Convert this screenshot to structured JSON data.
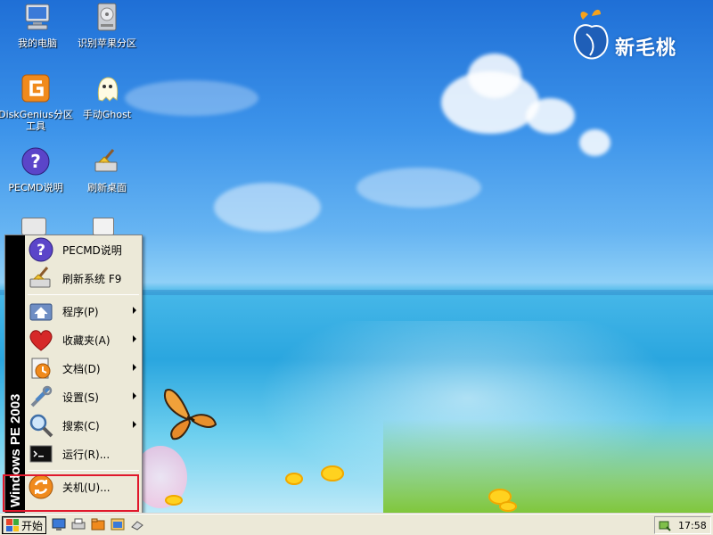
{
  "desktop": {
    "icons": [
      {
        "label": "我的电脑",
        "icon": "computer-icon"
      },
      {
        "label": "识别苹果分区",
        "icon": "drive-icon"
      },
      {
        "label": "DiskGenius分区工具",
        "icon": "diskgenius-icon"
      },
      {
        "label": "手动Ghost",
        "icon": "ghost-icon"
      },
      {
        "label": "PECMD说明",
        "icon": "help-icon"
      },
      {
        "label": "刷新桌面",
        "icon": "broom-icon"
      }
    ],
    "logo_text": "新毛桃"
  },
  "start_menu": {
    "banner": "Windows PE 2003",
    "top_items": [
      {
        "label": "PECMD说明",
        "icon": "help-icon"
      },
      {
        "label": "刷新系统 F9",
        "icon": "broom-icon"
      }
    ],
    "items": [
      {
        "label": "程序(P)",
        "icon": "programs-icon",
        "submenu": true
      },
      {
        "label": "收藏夹(A)",
        "icon": "heart-icon",
        "submenu": true
      },
      {
        "label": "文档(D)",
        "icon": "documents-icon",
        "submenu": true
      },
      {
        "label": "设置(S)",
        "icon": "settings-icon",
        "submenu": true
      },
      {
        "label": "搜索(C)",
        "icon": "search-icon",
        "submenu": true
      },
      {
        "label": "运行(R)...",
        "icon": "run-icon",
        "submenu": false
      }
    ],
    "shutdown": {
      "label": "关机(U)...",
      "icon": "shutdown-icon"
    }
  },
  "taskbar": {
    "start_label": "开始",
    "quick_launch": [
      "desktop-icon",
      "printer-icon",
      "folder-icon",
      "explorer-icon",
      "eraser-icon"
    ],
    "clock": "17:58"
  },
  "colors": {
    "highlight": "#e0182c",
    "sky": "#3c93ea",
    "taskbar": "#ece9d8"
  }
}
